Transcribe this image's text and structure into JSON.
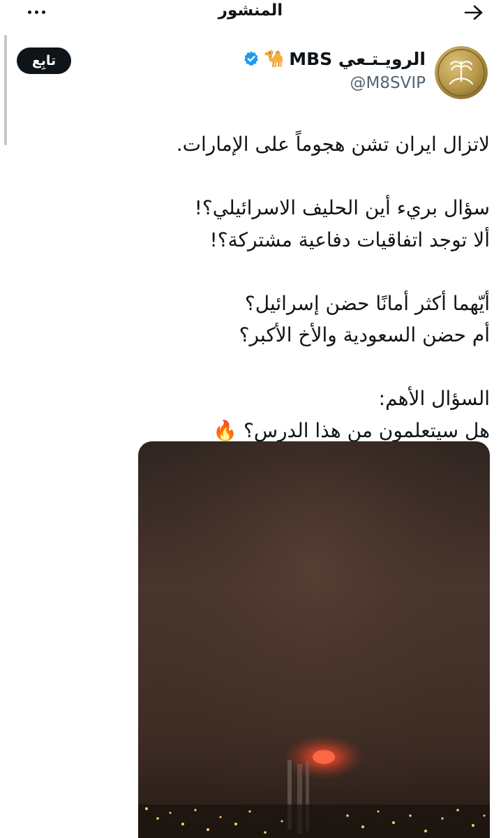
{
  "header": {
    "title": "المنشور"
  },
  "author": {
    "name": "الرويـتـعي MBS",
    "emoji": "🐪",
    "handle": "@M8SVIP",
    "follow_label": "تابِع"
  },
  "tweet": {
    "lines": [
      "لاتزال ايران تشن هجوماً على الإمارات.",
      "",
      "سؤال بريء أين الحليف الاسرائيلي؟!",
      "ألا توجد اتفاقيات دفاعية مشتركة؟!",
      "",
      "أيّهما أكثر أمانًا حضن إسرائيل؟",
      "أم حضن السعودية والأخ الأكبر؟",
      "",
      "السؤال الأهم:",
      "هل سيتعلمون من هذا الدرس؟ 🔥"
    ]
  },
  "colors": {
    "text": "#0f1419",
    "secondary": "#536471",
    "verified": "#1d9bf0",
    "follow_bg": "#0f1419",
    "avatar_gold": "#b89a4a"
  },
  "icons": {
    "back": "arrow-right-icon",
    "more": "more-horizontal-icon",
    "verified": "verified-badge-icon"
  }
}
